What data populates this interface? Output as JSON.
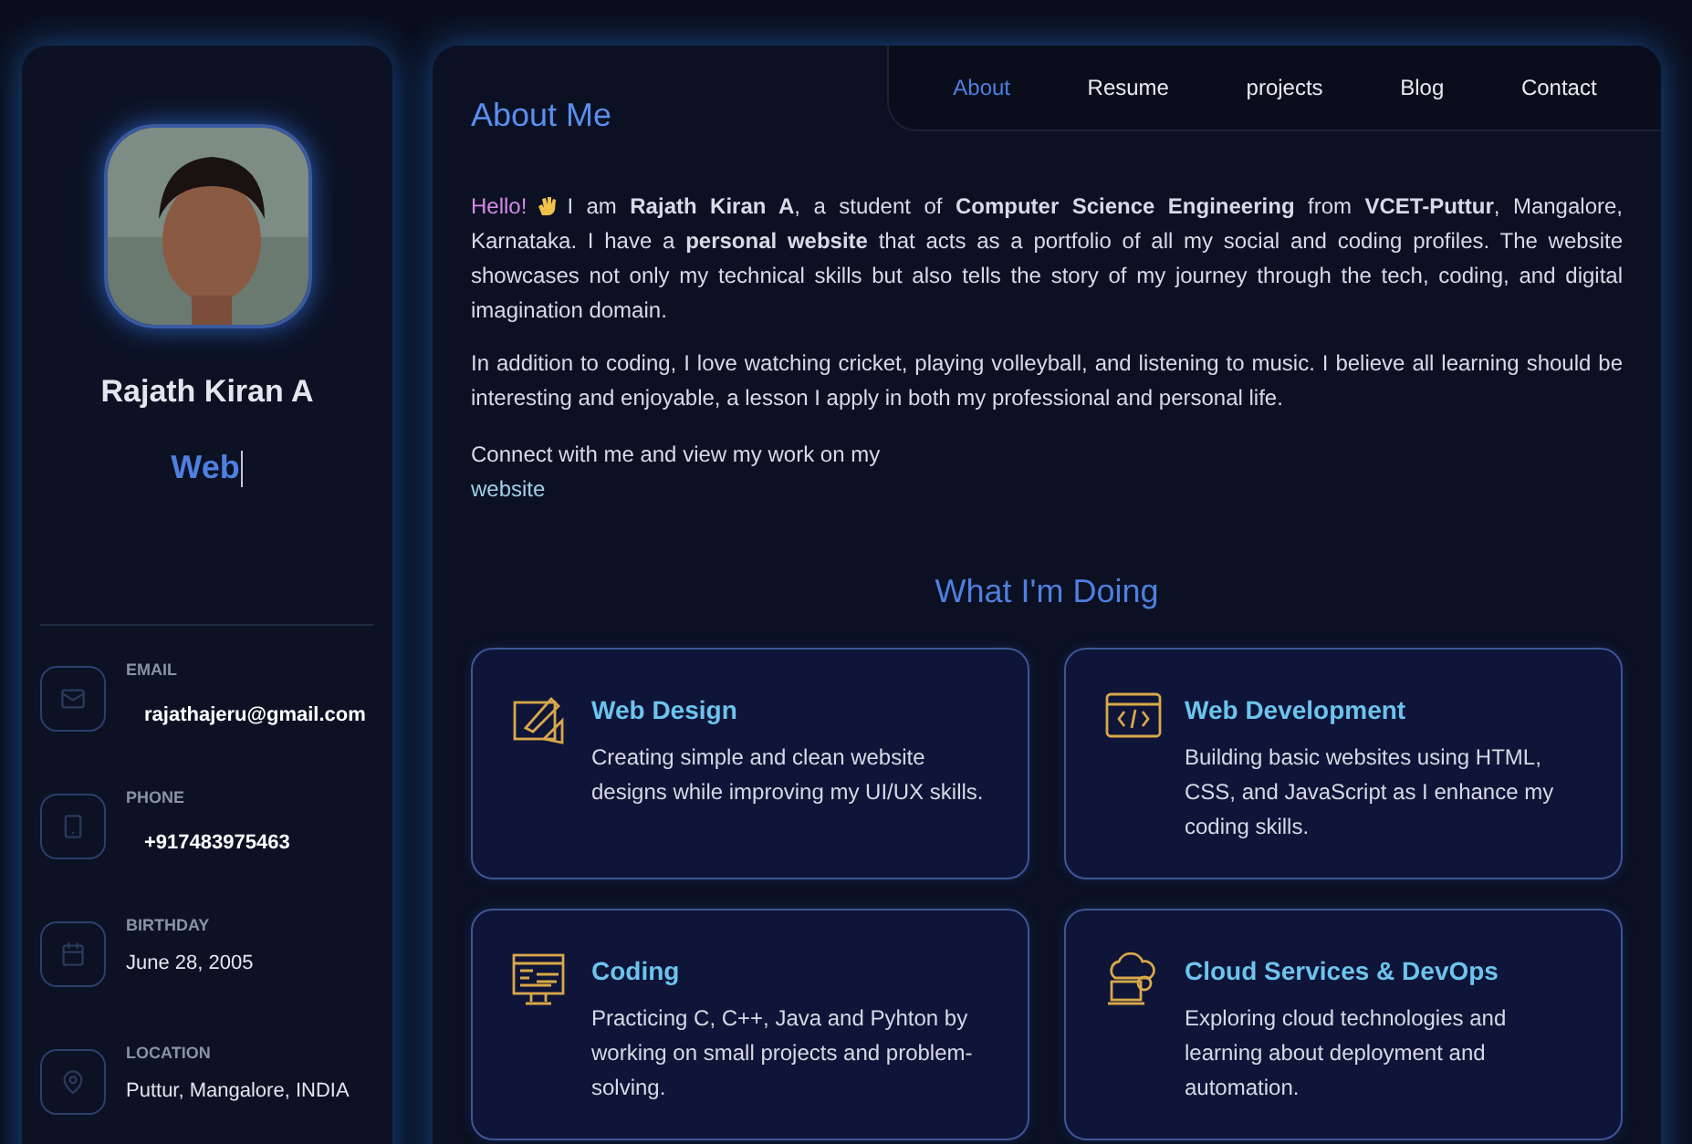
{
  "sidebar": {
    "name": "Rajath Kiran A",
    "role_typed": "Web",
    "contacts": [
      {
        "kind": "email",
        "label": "EMAIL",
        "value": "rajathajeru@gmail.com"
      },
      {
        "kind": "phone",
        "label": "PHONE",
        "value": "+917483975463"
      },
      {
        "kind": "birthday",
        "label": "BIRTHDAY",
        "value": "June 28, 2005"
      },
      {
        "kind": "location",
        "label": "LOCATION",
        "value": "Puttur, Mangalore, INDIA"
      }
    ]
  },
  "nav": [
    {
      "label": "About",
      "selected": true
    },
    {
      "label": "Resume",
      "selected": false
    },
    {
      "label": "projects",
      "selected": false
    },
    {
      "label": "Blog",
      "selected": false
    },
    {
      "label": "Contact",
      "selected": false
    }
  ],
  "about": {
    "title": "About Me",
    "greeting": "Hello!",
    "paragraphs": [
      "I am **Rajath Kiran A**, a student of **Computer Science Engineering** from **VCET-Puttur**, Mangalore, Karnataka. I have a **personal website** that acts as a portfolio of all my social and coding profiles. The website showcases not only my technical skills but also tells the story of my journey through the tech, coding, and digital imagination domain.",
      "In addition to coding, I love watching cricket, playing volleyball, and listening to music. I believe all learning should be interesting and enjoyable, a lesson I apply in both my professional and personal life."
    ],
    "connect_text": "Connect with me and view my work on my",
    "link": "website"
  },
  "services": {
    "title": "What I'm Doing",
    "items": [
      {
        "kind": "design",
        "title": "Web Design",
        "text": "Creating simple and clean website designs while improving my UI/UX skills."
      },
      {
        "kind": "webdev",
        "title": "Web Development",
        "text": "Building basic websites using HTML, CSS, and JavaScript as I enhance my coding skills."
      },
      {
        "kind": "coding",
        "title": "Coding",
        "text": "Practicing C, C++, Java and Pyhton by working on small projects and problem-solving."
      },
      {
        "kind": "cloud",
        "title": "Cloud Services & DevOps",
        "text": "Exploring cloud technologies and learning about deployment and automation."
      }
    ]
  }
}
